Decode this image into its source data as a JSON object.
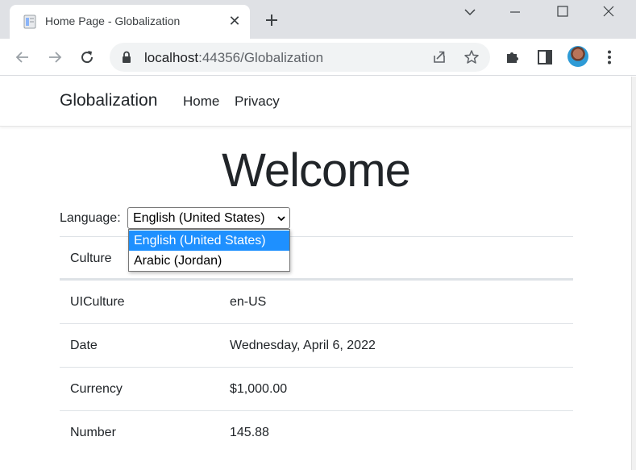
{
  "browser": {
    "tab_title": "Home Page - Globalization",
    "url_host": "localhost",
    "url_path": ":44356/Globalization"
  },
  "nav": {
    "brand": "Globalization",
    "links": [
      "Home",
      "Privacy"
    ]
  },
  "main": {
    "heading": "Welcome",
    "language_label": "Language:",
    "language_selected": "English (United States)",
    "language_options": [
      "English (United States)",
      "Arabic (Jordan)"
    ],
    "table": {
      "header_key": "Culture",
      "rows": [
        {
          "key": "UICulture",
          "value": "en-US"
        },
        {
          "key": "Date",
          "value": "Wednesday, April 6, 2022"
        },
        {
          "key": "Currency",
          "value": "$1,000.00"
        },
        {
          "key": "Number",
          "value": "145.88"
        }
      ]
    }
  },
  "colors": {
    "selection": "#1e90ff",
    "chrome": "#dfe1e5",
    "text": "#212529"
  }
}
